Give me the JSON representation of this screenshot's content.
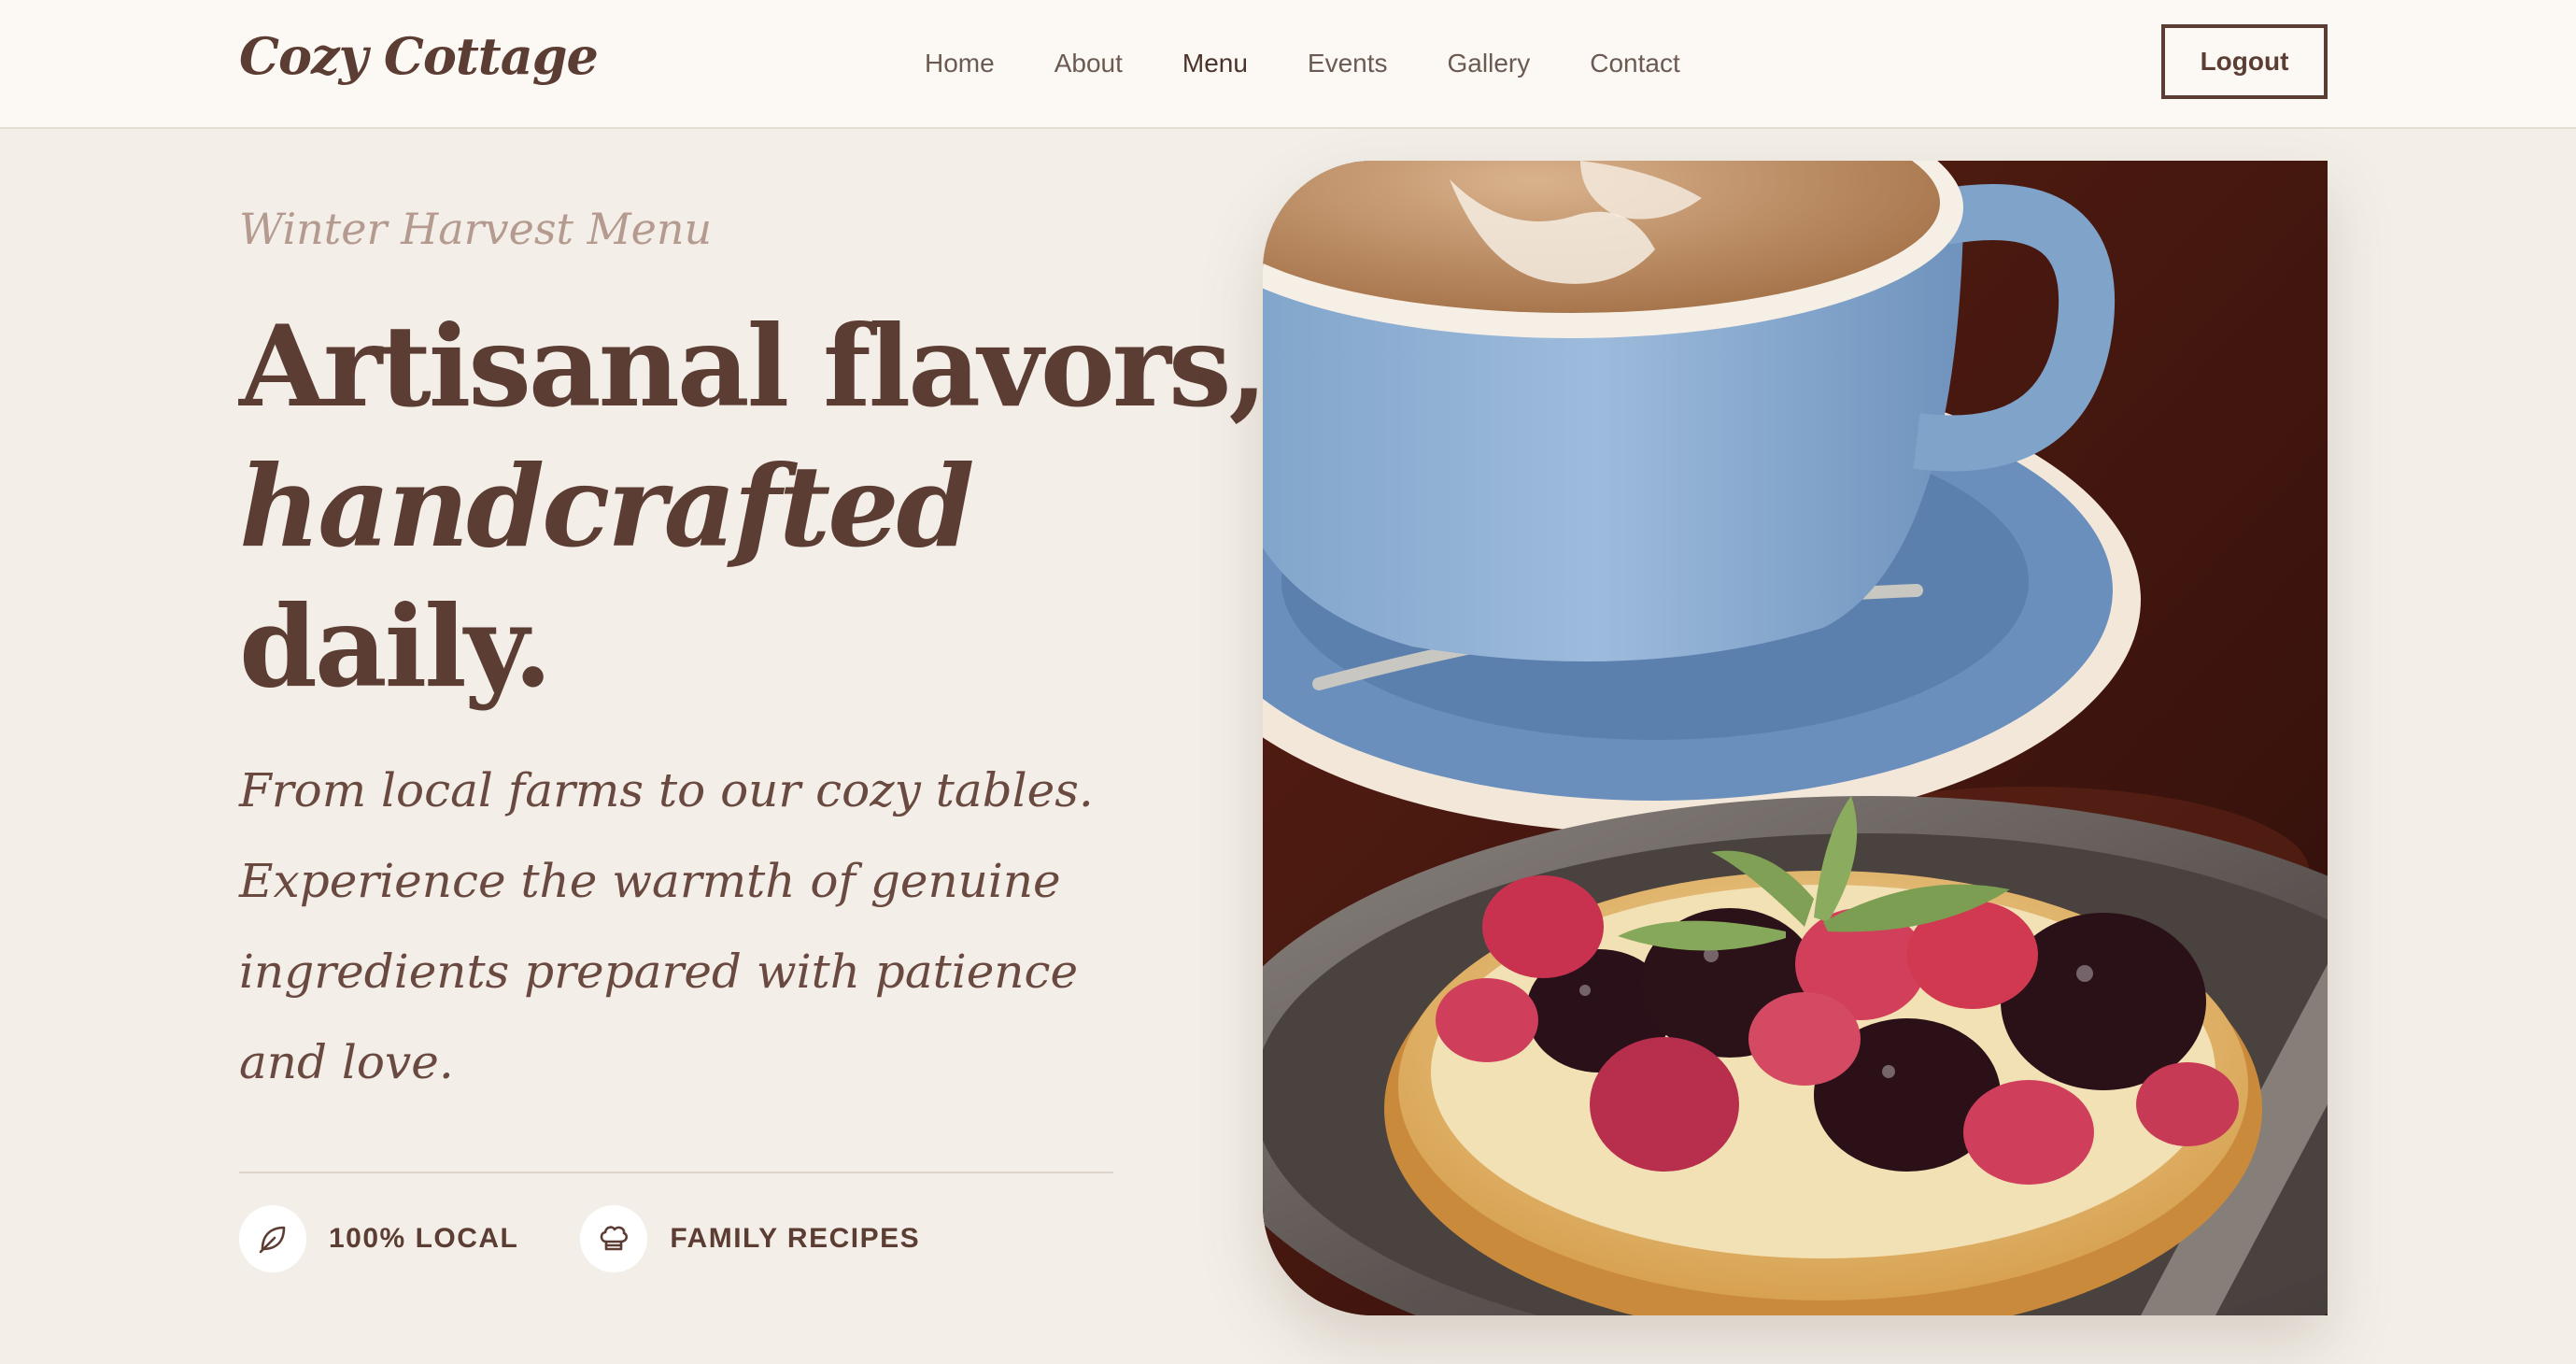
{
  "nav": {
    "brand": "Cozy Cottage",
    "links": [
      "Home",
      "About",
      "Menu",
      "Events",
      "Gallery",
      "Contact"
    ],
    "logout_label": "Logout"
  },
  "hero": {
    "kicker": "Winter Harvest Menu",
    "headline_line1": "Artisanal flavors,",
    "headline_line2": "handcrafted",
    "headline_line3": "daily.",
    "intro": "From local farms to our cozy tables. Experience the warmth of genuine ingredients prepared with patience and love.",
    "features": [
      {
        "icon": "leaf-icon",
        "label": "100% LOCAL"
      },
      {
        "icon": "chef-hat-icon",
        "label": "FAMILY RECIPES"
      }
    ],
    "image": "coffee-and-berry-tart-photo"
  },
  "colors": {
    "brand_brown": "#5c3d33",
    "background": "#f3efe8",
    "nav_background": "#fcf9f5",
    "kicker": "#b59a90"
  }
}
